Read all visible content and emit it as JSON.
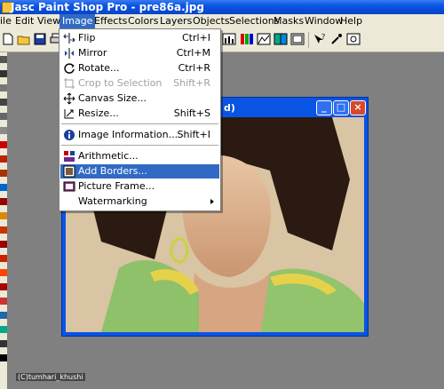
{
  "window": {
    "title": "Jasc Paint Shop Pro - pre86a.jpg"
  },
  "menubar": {
    "items": [
      "ile",
      "Edit",
      "View",
      "Image",
      "Effects",
      "Colors",
      "Layers",
      "Objects",
      "Selections",
      "Masks",
      "Window",
      "Help"
    ],
    "active": "Image"
  },
  "image_menu": {
    "items": [
      {
        "label": "Flip",
        "shortcut": "Ctrl+I",
        "icon": "flip-icon",
        "enabled": true
      },
      {
        "label": "Mirror",
        "shortcut": "Ctrl+M",
        "icon": "mirror-icon",
        "enabled": true
      },
      {
        "label": "Rotate...",
        "shortcut": "Ctrl+R",
        "icon": "rotate-icon",
        "enabled": true
      },
      {
        "label": "Crop to Selection",
        "shortcut": "Shift+R",
        "icon": "crop-icon",
        "enabled": false
      },
      {
        "label": "Canvas Size...",
        "shortcut": "",
        "icon": "canvas-size-icon",
        "enabled": true
      },
      {
        "label": "Resize...",
        "shortcut": "Shift+S",
        "icon": "resize-icon",
        "enabled": true
      },
      {
        "label": "Image Information...",
        "shortcut": "Shift+I",
        "icon": "info-icon",
        "enabled": true
      },
      {
        "label": "Arithmetic...",
        "shortcut": "",
        "icon": "arithmetic-icon",
        "enabled": true
      },
      {
        "label": "Add Borders...",
        "shortcut": "",
        "icon": "add-borders-icon",
        "enabled": true,
        "highlighted": true
      },
      {
        "label": "Picture Frame...",
        "shortcut": "",
        "icon": "picture-frame-icon",
        "enabled": true
      },
      {
        "label": "Watermarking",
        "shortcut": "",
        "icon": "",
        "enabled": true,
        "submenu": true
      }
    ]
  },
  "document": {
    "caption_fragment": "d)"
  },
  "watermark": {
    "text": "(C)tumhari_khushi"
  },
  "colors": {
    "titlebar": "#0a54e4",
    "highlight": "#316ac5",
    "menu_bg": "#ffffff",
    "workspace": "#808080"
  }
}
